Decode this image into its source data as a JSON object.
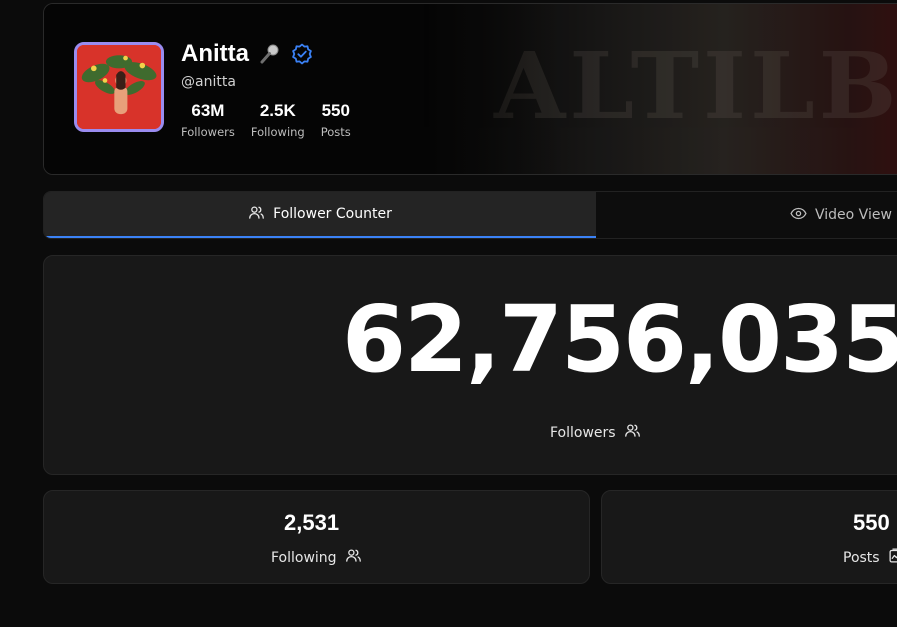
{
  "profile": {
    "name": "Anitta",
    "handle": "@anitta",
    "stats": [
      {
        "value": "63M",
        "label": "Followers"
      },
      {
        "value": "2.5K",
        "label": "Following"
      },
      {
        "value": "550",
        "label": "Posts"
      }
    ],
    "banner_text": "ALTILBRINAT",
    "icons": {
      "mic": "microphone-icon",
      "verified": "verified-badge-icon"
    },
    "accent_color": "#3b82f6",
    "avatar_border_color": "#9a8cf0"
  },
  "tabs": [
    {
      "label": "Follower Counter",
      "icon": "users-icon",
      "active": true
    },
    {
      "label": "Video View C",
      "icon": "eye-icon",
      "active": false
    }
  ],
  "counter": {
    "value": "62,756,035",
    "label": "Followers",
    "icon": "users-icon"
  },
  "cards": [
    {
      "value": "2,531",
      "label": "Following",
      "icon": "users-icon"
    },
    {
      "value": "550",
      "label": "Posts",
      "icon": "posts-icon"
    }
  ]
}
